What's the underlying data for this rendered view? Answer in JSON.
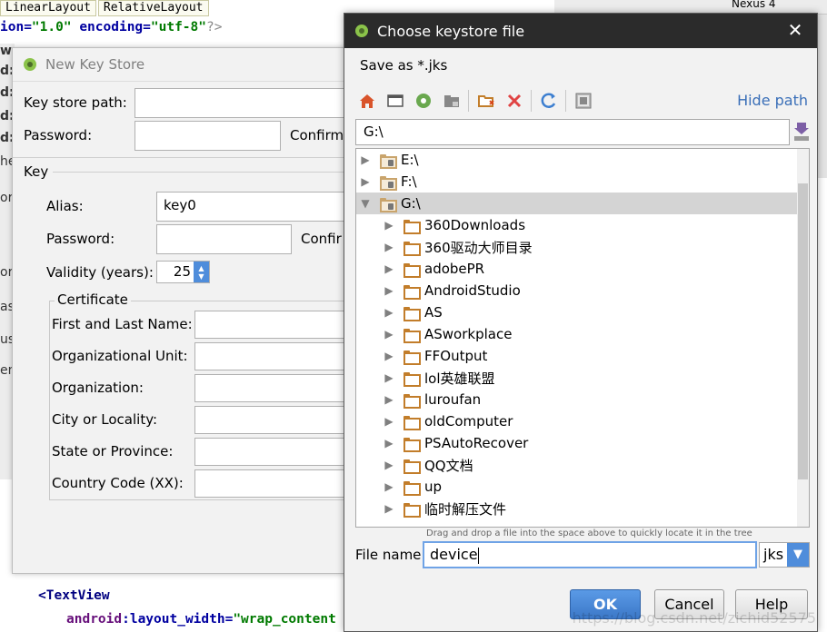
{
  "ide": {
    "tabs": [
      "LinearLayout",
      "RelativeLayout"
    ],
    "xml_decl": {
      "attr1": "ion=",
      "val1": "\"1.0\"",
      "attr2": "encoding=",
      "val2": "\"utf-8\"",
      "end": "?>"
    },
    "left_gutter": [
      "w",
      "d:",
      "d:",
      "d:",
      "d:",
      "he",
      "or",
      "or",
      "as",
      "uss",
      "em"
    ],
    "bottom_code": {
      "line1_tag": "<TextView",
      "line2_ns": "android",
      "line2_attr": ":layout_width=",
      "line2_val": "\"wrap_content"
    },
    "top_right_label": "Nexus 4"
  },
  "new_key_store": {
    "title": "New Key Store",
    "key_store_path_label": "Key store path:",
    "password_label": "Password:",
    "confirm_label": "Confirm",
    "key_section_label": "Key",
    "alias_label": "Alias:",
    "alias_value": "key0",
    "key_password_label": "Password:",
    "key_confirm_label": "Confir",
    "validity_label": "Validity (years):",
    "validity_value": "25",
    "certificate_label": "Certificate",
    "cert_fields": [
      "First and Last Name:",
      "Organizational Unit:",
      "Organization:",
      "City or Locality:",
      "State or Province:",
      "Country Code (XX):"
    ]
  },
  "chooser": {
    "title": "Choose keystore file",
    "close_glyph": "✕",
    "save_as": "Save as *.jks",
    "toolbar_icons": [
      "home-icon",
      "desktop-icon",
      "android-project-icon",
      "module-icon",
      "new-folder-icon",
      "delete-icon",
      "refresh-icon",
      "show-hidden-icon"
    ],
    "hide_path": "Hide path",
    "path_value": "G:\\",
    "drives": [
      {
        "label": "E:\\",
        "expanded": false,
        "selected": false
      },
      {
        "label": "F:\\",
        "expanded": false,
        "selected": false
      },
      {
        "label": "G:\\",
        "expanded": true,
        "selected": true
      }
    ],
    "folders": [
      "360Downloads",
      "360驱动大师目录",
      "adobePR",
      "AndroidStudio",
      "AS",
      "ASworkplace",
      "FFOutput",
      "lol英雄联盟",
      "luroufan",
      "oldComputer",
      "PSAutoRecover",
      "QQ文档",
      "up",
      "临时解压文件"
    ],
    "hint": "Drag and drop a file into the space above to quickly locate it in the tree",
    "file_name_label": "File name:",
    "file_name_value": "device",
    "extension": "jks",
    "ok_label": "OK",
    "cancel_label": "Cancel",
    "help_label": "Help",
    "watermark": "https://blog.csdn.net/zichid52575"
  },
  "colors": {
    "title_bar": "#2b2b2b",
    "accent_blue": "#4f8ddb",
    "folder": "#c27d2a",
    "link": "#3a6fb8"
  }
}
